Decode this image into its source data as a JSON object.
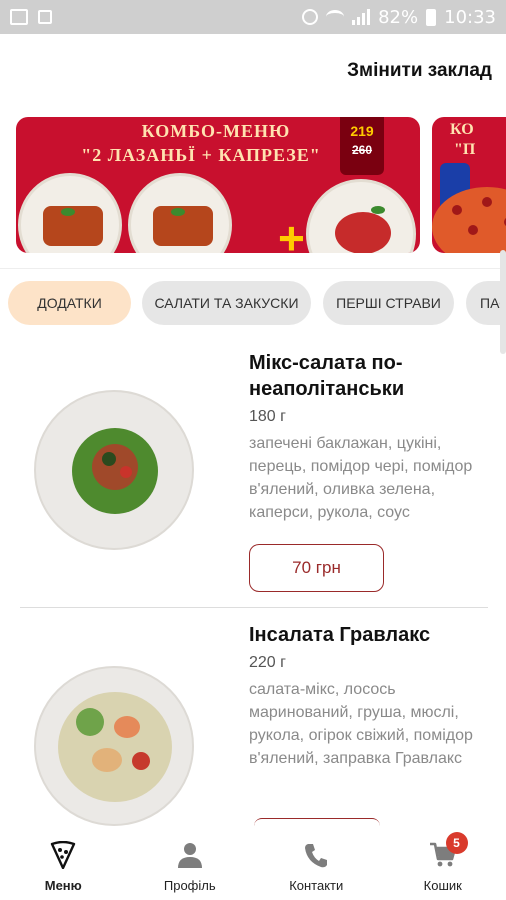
{
  "status_bar": {
    "battery": "82%",
    "time": "10:33"
  },
  "header": {
    "change_venue_label": "Змінити заклад"
  },
  "banners": [
    {
      "title": "КОМБО-МЕНЮ",
      "subtitle": "\"2 ЛАЗАНЬЇ + КАПРЕЗЕ\"",
      "price_new": "219",
      "price_old": "260",
      "plus_sign": "+"
    },
    {
      "title": "КО",
      "subtitle": "\"П"
    }
  ],
  "tabs": [
    {
      "label": "ДОДАТКИ",
      "active": true
    },
    {
      "label": "САЛАТИ ТА ЗАКУСКИ",
      "active": false
    },
    {
      "label": "ПЕРШІ СТРАВИ",
      "active": false
    },
    {
      "label": "ПАС",
      "active": false
    }
  ],
  "items": [
    {
      "name": "Мікс-салата по-неаполітанськи",
      "weight": "180 г",
      "description": "запечені баклажан, цукіні, перець, помідор чері, помідор в'ялений, оливка зелена, каперси, рукола, соус",
      "price": "70 грн"
    },
    {
      "name": "Інсалата Гравлакс",
      "weight": "220 г",
      "description": "салата-мікс, лосось маринований, груша, мюслі,  рукола, огірок свіжий, помідор в'ялений, заправка Гравлакс"
    }
  ],
  "bottom_nav": [
    {
      "label": "Меню",
      "icon": "pizza-slice-icon",
      "active": true
    },
    {
      "label": "Профіль",
      "icon": "person-icon",
      "active": false
    },
    {
      "label": "Контакти",
      "icon": "phone-icon",
      "active": false
    },
    {
      "label": "Кошик",
      "icon": "cart-icon",
      "active": false,
      "badge": "5"
    }
  ],
  "colors": {
    "accent": "#9a2a2a",
    "active_tab": "#fde3c8",
    "banner_red": "#c8102e",
    "badge": "#d93a2c"
  }
}
